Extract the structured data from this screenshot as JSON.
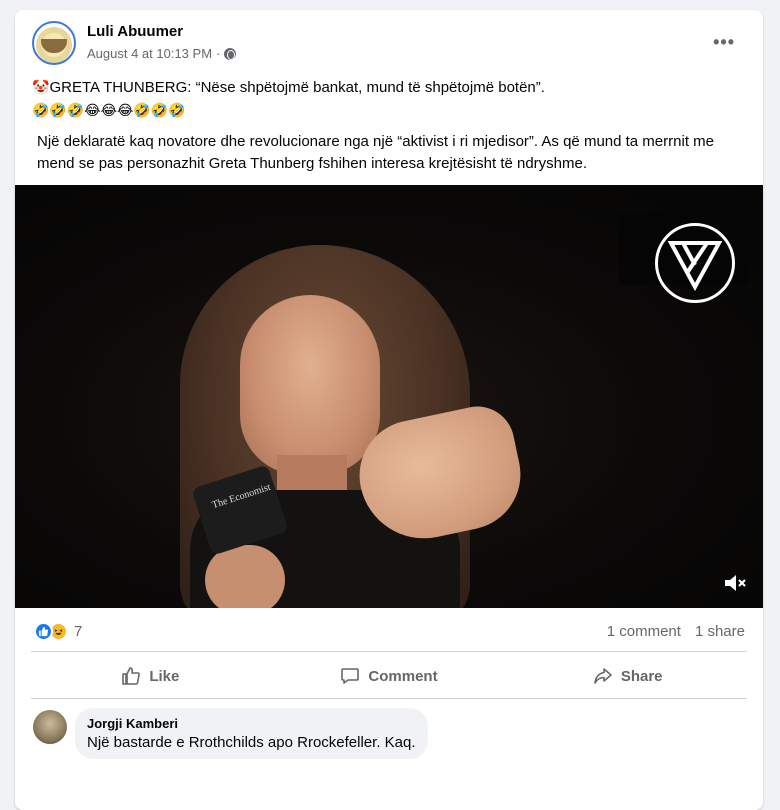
{
  "post": {
    "author": "Luli Abuumer",
    "date": "August 4 at 10:13 PM",
    "separator": "·",
    "more_label": "•••",
    "line1": "GRETA THUNBERG: “Nëse shpëtojmë bankat, mund të shpëtojmë botën”.",
    "line1_prefix_emoji": "🤡",
    "line2": "🤣🤣🤣😂😂😂🤣🤣🤣",
    "paragraph": "Një deklaratë kaq novatore dhe revolucionare nga një “aktivist i ri mjedisor”.  As që mund ta merrnit me mend se pas personazhit Greta Thunberg fshihen interesa krejtësisht të ndryshme.",
    "video_mic_label": "The Economist"
  },
  "reactions": {
    "count": "7",
    "comments": "1 comment",
    "shares": "1 share"
  },
  "actions": {
    "like": "Like",
    "comment": "Comment",
    "share": "Share"
  },
  "comment": {
    "author": "Jorgji Kamberi",
    "text": "Një bastarde e Rrothchilds apo Rrockefeller. Kaq."
  },
  "colors": {
    "accent": "#1877f2",
    "muted": "#65676b",
    "background": "#f0f2f5"
  }
}
